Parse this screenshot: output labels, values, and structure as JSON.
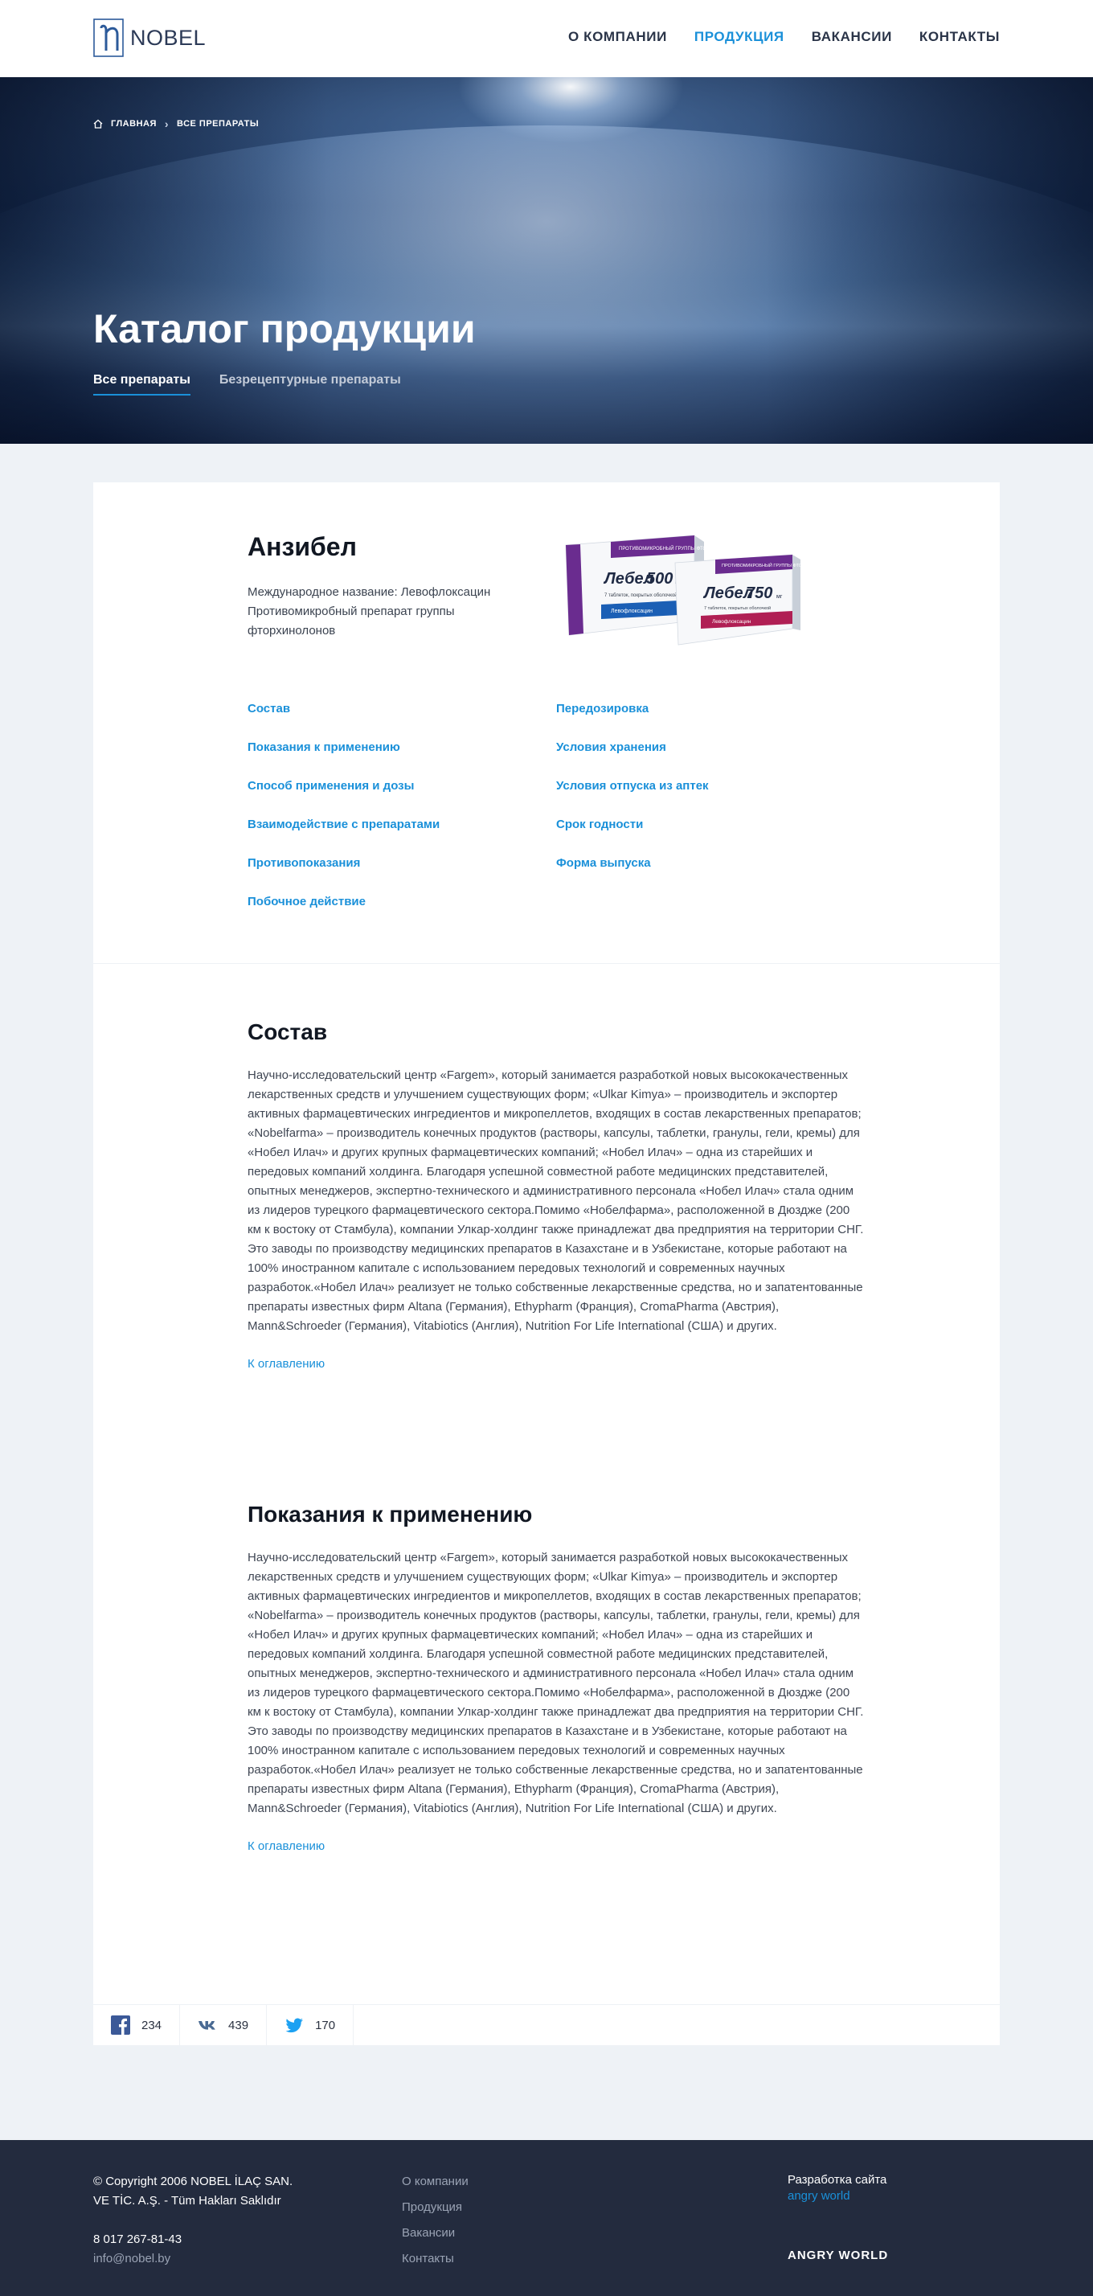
{
  "header": {
    "logo_text": "NOBEL",
    "nav": [
      {
        "label": "О КОМПАНИИ",
        "active": false
      },
      {
        "label": "ПРОДУКЦИЯ",
        "active": true
      },
      {
        "label": "ВАКАНСИИ",
        "active": false
      },
      {
        "label": "КОНТАКТЫ",
        "active": false
      }
    ]
  },
  "hero": {
    "breadcrumb": [
      "ГЛАВНАЯ",
      "ВСЕ ПРЕПАРАТЫ"
    ],
    "title": "Каталог продукции",
    "tabs": [
      {
        "label": "Все препараты",
        "active": true
      },
      {
        "label": "Безрецептурные препараты",
        "active": false
      }
    ]
  },
  "product": {
    "name": "Анзибел",
    "description": "Международное название: Левофлоксацин Противомикробный препарат группы фторхинолонов",
    "pack_images": [
      {
        "brand": "Лебел",
        "dose": "500",
        "unit": "мг",
        "band_text": "Левофлоксацин",
        "tagline": "ПРОТИВОМИКРОБНЫЙ ГРУППЫ ФТОРХИНОЛОНОВ",
        "count_text": "7 таблеток, покрытых оболочкой"
      },
      {
        "brand": "Лебел",
        "dose": "750",
        "unit": "мг",
        "band_text": "Левофлоксацин",
        "tagline": "ПРОТИВОМИКРОБНЫЙ ГРУППЫ ФТОРХИНОЛОНОВ",
        "count_text": "7 таблеток, покрытых оболочкой"
      }
    ],
    "toc_left": [
      "Состав",
      "Показания к применению",
      "Способ применения и дозы",
      "Взаимодействие с препаратами",
      "Противопоказания",
      "Побочное действие"
    ],
    "toc_right": [
      "Передозировка",
      "Условия хранения",
      "Условия отпуска из аптек",
      "Срок годности",
      "Форма выпуска"
    ]
  },
  "sections": [
    {
      "title": "Состав",
      "text": "Научно-исследовательский центр «Fargem», который занимается разработкой новых высококачественных лекарственных средств и улучшением существующих форм; «Ulkar Kimya» – производитель и экспортер активных фармацевтических ингредиентов и микропеллетов, входящих в состав лекарственных препаратов; «Nobelfarma» – производитель конечных продуктов (растворы, капсулы, таблетки, гранулы, гели, кремы) для «Нобел Илач» и других крупных фармацевтических компаний;   «Нобел Илач» – одна из старейших и передовых компаний холдинга. Благодаря успешной совместной работе медицинских представителей, опытных менеджеров, экспертно-технического и административного персонала «Нобел Илач» стала одним из лидеров турецкого фармацевтического сектора.Помимо «Нобелфарма», расположенной в Дюздже (200 км к востоку от Стамбула), компании Улкар-холдинг также принадлежат два предприятия на территории СНГ. Это заводы по производству медицинских препаратов в Казахстане и в Узбекистане, которые работают на 100% иностранном капитале с использованием передовых технологий и современных научных разработок.«Нобел Илач» реализует не только собственные лекарственные средства, но и запатентованные препараты известных фирм Altana (Германия), Ethypharm (Франция), CromaPharma (Австрия), Mann&Schroeder (Германия), Vitabiotics (Англия), Nutrition For Life International (США) и других.",
      "back_label": "К оглавлению"
    },
    {
      "title": "Показания к применению",
      "text": "Научно-исследовательский центр «Fargem», который занимается разработкой новых высококачественных лекарственных средств и улучшением существующих форм; «Ulkar Kimya» – производитель и экспортер активных фармацевтических ингредиентов и микропеллетов, входящих в состав лекарственных препаратов; «Nobelfarma» – производитель конечных продуктов (растворы, капсулы, таблетки, гранулы, гели, кремы) для «Нобел Илач» и других крупных фармацевтических компаний;   «Нобел Илач» – одна из старейших и передовых компаний холдинга. Благодаря успешной совместной работе медицинских представителей, опытных менеджеров, экспертно-технического и административного персонала «Нобел Илач» стала одним из лидеров турецкого фармацевтического сектора.Помимо «Нобелфарма», расположенной в Дюздже (200 км к востоку от Стамбула), компании Улкар-холдинг также принадлежат два предприятия на территории СНГ. Это заводы по производству медицинских препаратов в Казахстане и в Узбекистане, которые работают на 100% иностранном капитале с использованием передовых технологий и современных научных разработок.«Нобел Илач» реализует не только собственные лекарственные средства, но и запатентованные препараты известных фирм Altana (Германия), Ethypharm (Франция), CromaPharma (Австрия), Mann&Schroeder (Германия), Vitabiotics (Англия), Nutrition For Life International (США) и других.",
      "back_label": "К оглавлению"
    }
  ],
  "share": [
    {
      "network": "facebook-icon",
      "count": "234",
      "color": "#3b5998"
    },
    {
      "network": "vk-icon",
      "count": "439",
      "color": "#4a6a93"
    },
    {
      "network": "twitter-icon",
      "count": "170",
      "color": "#1da1f2"
    }
  ],
  "footer": {
    "copyright_line1": "© Copyright 2006 NOBEL İLAÇ SAN.",
    "copyright_line2": "VE TİC. A.Ş. - Tüm Hakları Saklıdır",
    "phone": "8 017 267-81-43",
    "email": "info@nobel.by",
    "links": [
      "О компании",
      "Продукция",
      "Вакансии",
      "Контакты"
    ],
    "dev_label": "Разработка сайта",
    "dev_link": "angry world",
    "dev_logo": "ANGRY WORLD"
  },
  "colors": {
    "accent": "#1a90d9",
    "footer_bg": "#232b3e",
    "page_bg": "#eef2f6"
  }
}
